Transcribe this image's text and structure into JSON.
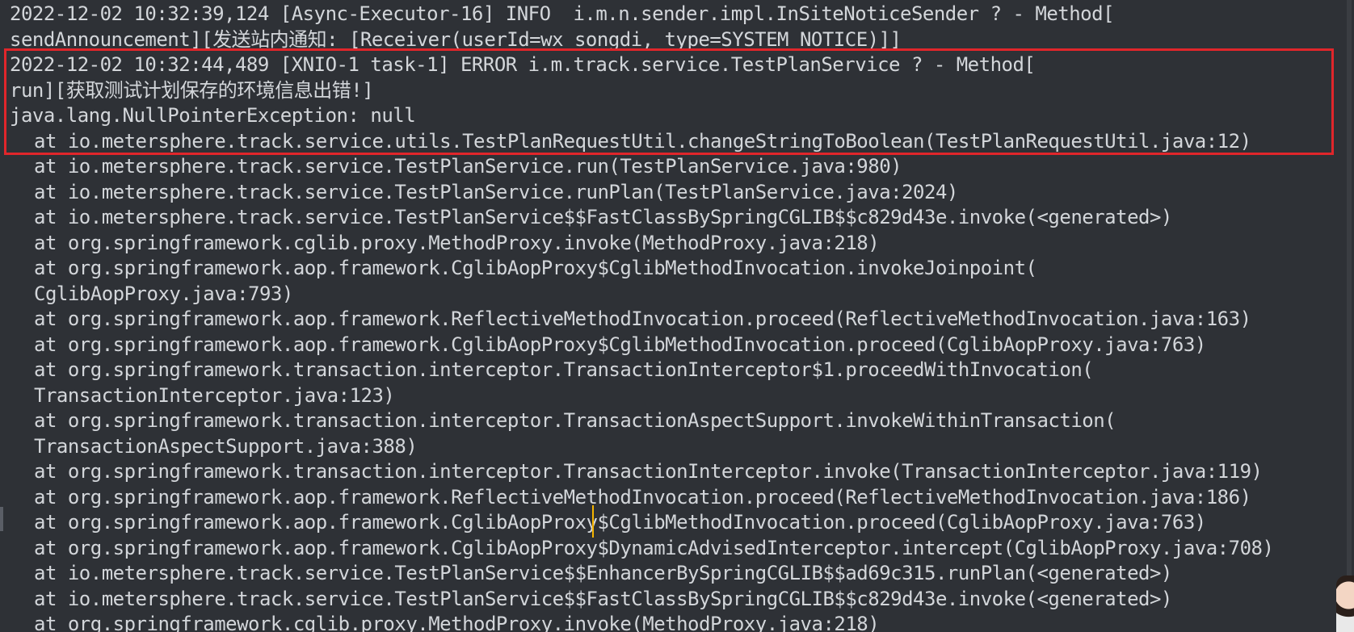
{
  "log_lines": [
    {
      "text": "2022-12-02 10:32:39,124 [Async-Executor-16] INFO  i.m.n.sender.impl.InSiteNoticeSender ? - Method[",
      "indent": false
    },
    {
      "text": "sendAnnouncement][发送站内通知: [Receiver(userId=wx_songdi, type=SYSTEM_NOTICE)]]",
      "indent": false
    },
    {
      "text": "2022-12-02 10:32:44,489 [XNIO-1 task-1] ERROR i.m.track.service.TestPlanService ? - Method[",
      "indent": false
    },
    {
      "text": "run][获取测试计划保存的环境信息出错!]",
      "indent": false
    },
    {
      "text": "java.lang.NullPointerException: null",
      "indent": false
    },
    {
      "text": "at io.metersphere.track.service.utils.TestPlanRequestUtil.changeStringToBoolean(TestPlanRequestUtil.java:12)",
      "indent": true
    },
    {
      "text": "at io.metersphere.track.service.TestPlanService.run(TestPlanService.java:980)",
      "indent": true
    },
    {
      "text": "at io.metersphere.track.service.TestPlanService.runPlan(TestPlanService.java:2024)",
      "indent": true
    },
    {
      "text": "at io.metersphere.track.service.TestPlanService$$FastClassBySpringCGLIB$$c829d43e.invoke(<generated>)",
      "indent": true
    },
    {
      "text": "at org.springframework.cglib.proxy.MethodProxy.invoke(MethodProxy.java:218)",
      "indent": true
    },
    {
      "text": "at org.springframework.aop.framework.CglibAopProxy$CglibMethodInvocation.invokeJoinpoint(",
      "indent": true
    },
    {
      "text": "CglibAopProxy.java:793)",
      "indent": true
    },
    {
      "text": "at org.springframework.aop.framework.ReflectiveMethodInvocation.proceed(ReflectiveMethodInvocation.java:163)",
      "indent": true
    },
    {
      "text": "at org.springframework.aop.framework.CglibAopProxy$CglibMethodInvocation.proceed(CglibAopProxy.java:763)",
      "indent": true
    },
    {
      "text": "at org.springframework.transaction.interceptor.TransactionInterceptor$1.proceedWithInvocation(",
      "indent": true
    },
    {
      "text": "TransactionInterceptor.java:123)",
      "indent": true
    },
    {
      "text": "at org.springframework.transaction.interceptor.TransactionAspectSupport.invokeWithinTransaction(",
      "indent": true
    },
    {
      "text": "TransactionAspectSupport.java:388)",
      "indent": true
    },
    {
      "text": "at org.springframework.transaction.interceptor.TransactionInterceptor.invoke(TransactionInterceptor.java:119)",
      "indent": true
    },
    {
      "text": "at org.springframework.aop.framework.ReflectiveMethodInvocation.proceed(ReflectiveMethodInvocation.java:186)",
      "indent": true
    },
    {
      "text": "at org.springframework.aop.framework.CglibAopProxy$CglibMethodInvocation.proceed(CglibAopProxy.java:763)",
      "indent": true
    },
    {
      "text": "at org.springframework.aop.framework.CglibAopProxy$DynamicAdvisedInterceptor.intercept(CglibAopProxy.java:708)",
      "indent": true
    },
    {
      "text": "at io.metersphere.track.service.TestPlanService$$EnhancerBySpringCGLIB$$ad69c315.runPlan(<generated>)",
      "indent": true
    },
    {
      "text": "at io.metersphere.track.service.TestPlanService$$FastClassBySpringCGLIB$$c829d43e.invoke(<generated>)",
      "indent": true
    },
    {
      "text": "at org.springframework.cglib.proxy.MethodProxy.invoke(MethodProxy.java:218)",
      "indent": true
    }
  ],
  "colors": {
    "background": "#2e3136",
    "text": "#d3d6da",
    "highlight_border": "#e0262b",
    "cursor": "#f5b400"
  }
}
